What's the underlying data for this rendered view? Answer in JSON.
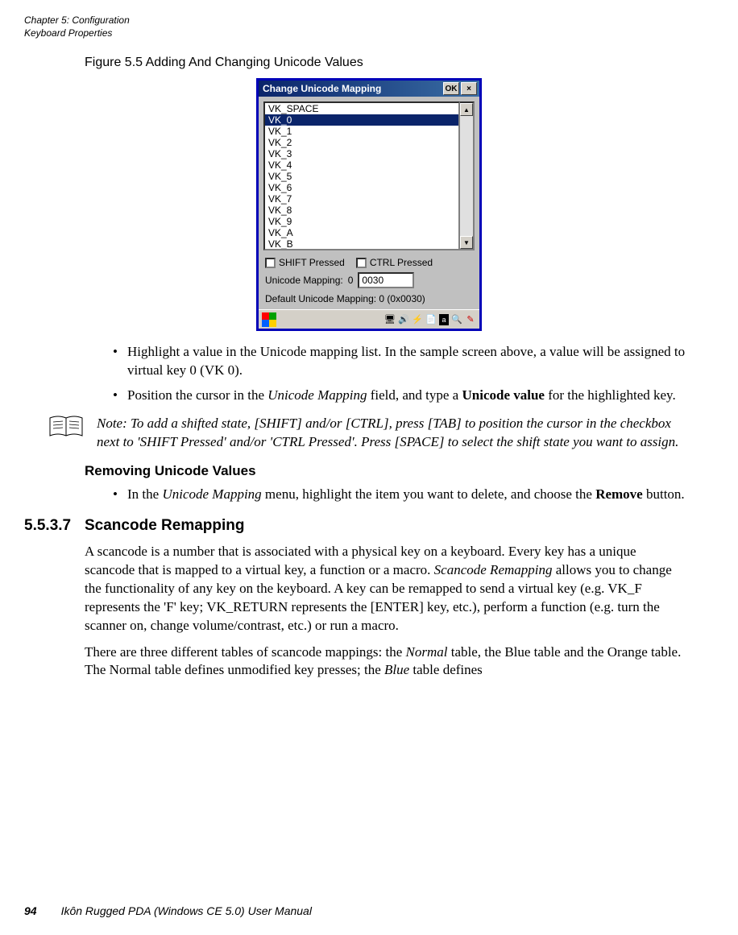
{
  "header": {
    "line1": "Chapter 5:  Configuration",
    "line2": "Keyboard Properties"
  },
  "figure_caption": "Figure 5.5  Adding And Changing Unicode Values",
  "screenshot": {
    "title": "Change Unicode Mapping",
    "ok_label": "OK",
    "close_label": "×",
    "list_items": [
      "VK_SPACE",
      "VK_0",
      "VK_1",
      "VK_2",
      "VK_3",
      "VK_4",
      "VK_5",
      "VK_6",
      "VK_7",
      "VK_8",
      "VK_9",
      "VK_A",
      "VK_B"
    ],
    "selected_index": 1,
    "shift_label": "SHIFT Pressed",
    "ctrl_label": "CTRL Pressed",
    "mapping_label": "Unicode Mapping:",
    "mapping_char": "0",
    "mapping_value": "0030",
    "default_label": "Default Unicode Mapping:   0  (0x0030)"
  },
  "bullets1": {
    "b1": "Highlight a value in the Unicode mapping list. In the sample screen above, a value will be assigned to virtual key 0 (VK 0).",
    "b2_pre": "Position the cursor in the ",
    "b2_em": "Unicode Mapping",
    "b2_mid": " field, and type a ",
    "b2_strong": "Unicode value",
    "b2_post": " for the highlighted key."
  },
  "note": {
    "prefix": "Note:",
    "text": " To add a shifted state, [SHIFT] and/or [CTRL], press [TAB] to position the cursor in the checkbox next to 'SHIFT Pressed' and/or 'CTRL Pressed'. Press [SPACE] to select the shift state you want to assign."
  },
  "subheading1": "Removing Unicode Values",
  "bullets2": {
    "b1_pre": "In the ",
    "b1_em": "Unicode Mapping",
    "b1_mid": " menu, highlight the item you want to delete, and choose the ",
    "b1_strong": "Remove",
    "b1_post": " button."
  },
  "section": {
    "number": "5.5.3.7",
    "title": "Scancode Remapping"
  },
  "para1": {
    "t1": "A scancode is a number that is associated with a physical key on a keyboard. Every key has a unique scancode that is mapped to a virtual key, a function or a macro. ",
    "em1": "Scancode Remapping",
    "t2": " allows you to change the functionality of any key on the keyboard. A key can be remapped to send a virtual key (e.g. VK_F represents the 'F' key; VK_RETURN represents the [ENTER] key, etc.), perform a function (e.g. turn the scanner on, change volume/contrast, etc.) or run a macro."
  },
  "para2": {
    "t1": "There are three different tables of scancode mappings: the ",
    "em1": "Normal",
    "t2": " table, the Blue table and the Orange table. The Normal table defines unmodified key presses; the ",
    "em2": "Blue",
    "t3": " table defines"
  },
  "footer": {
    "page": "94",
    "title": "Ikôn Rugged PDA (Windows CE 5.0) User Manual"
  }
}
